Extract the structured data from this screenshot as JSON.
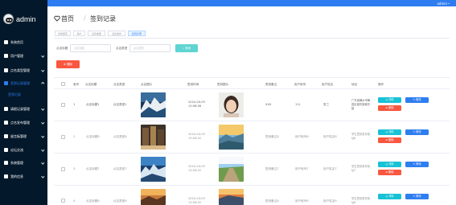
{
  "topbar": {
    "user": "admin"
  },
  "sidebar": {
    "brand": "admin",
    "items": [
      {
        "label": "系统首页",
        "has_arrow": false
      },
      {
        "label": "用户管理",
        "has_arrow": true
      },
      {
        "label": "点名类型管理",
        "has_arrow": true
      },
      {
        "label": "签到记录管理",
        "has_arrow": true,
        "active": true
      },
      {
        "label": "请假记录管理",
        "has_arrow": true
      },
      {
        "label": "点名发布管理",
        "has_arrow": true
      },
      {
        "label": "留言板管理",
        "has_arrow": true
      },
      {
        "label": "论坛交流",
        "has_arrow": true
      },
      {
        "label": "系统管理",
        "has_arrow": true
      },
      {
        "label": "我的信息",
        "has_arrow": true
      }
    ],
    "sub_item": "签到记录"
  },
  "header": {
    "home": "首页",
    "separator": "/",
    "current": "签到记录"
  },
  "tags": [
    "系统首页",
    "用户",
    "点名类型",
    "点名发布",
    "签到记录"
  ],
  "search": {
    "label1": "点名标题",
    "placeholder1": "点名标题",
    "label2": "点名类型",
    "placeholder2": "点名类型",
    "search_button": "查询"
  },
  "delete_button": "删除",
  "table": {
    "headers": [
      "索号",
      "点名标题",
      "点名类型",
      "点名图片",
      "签到时间",
      "签到图片",
      "签到备注",
      "用户帐号",
      "用户姓名",
      "地址",
      "操作"
    ],
    "rows": [
      {
        "index": "1",
        "title": "点名标题1",
        "type": "点名类型1",
        "time": "2024-04-09 13:58:56",
        "remark": "XXX",
        "account": "111",
        "name": "张三",
        "address": "广东省梅州市梅县区城东镇城东镇",
        "muted": false
      },
      {
        "index": "2",
        "title": "点名标题8",
        "type": "点名类型8",
        "time": "2024-04-09 13:56:52",
        "remark": "签到备注8",
        "account": "用户帐号8",
        "name": "用户姓名8",
        "address": "学生签到发布地址8",
        "muted": true
      },
      {
        "index": "3",
        "title": "点名标题7",
        "type": "点名类型7",
        "time": "2024-04-09 13:56:52",
        "remark": "签到备注7",
        "account": "用户帐号7",
        "name": "用户姓名7",
        "address": "学生签到发布地址7",
        "muted": true
      },
      {
        "index": "4",
        "title": "点名标题6",
        "type": "点名类型6",
        "time": "2024-04-09 13:56:52",
        "remark": "签到备注6",
        "account": "用户帐号6",
        "name": "用户姓名6",
        "address": "学生签到发布地址6",
        "muted": true
      }
    ],
    "actions": {
      "detail": "详情",
      "edit": "修改",
      "delete": "删除"
    }
  },
  "colors": {
    "primary": "#2e7df0",
    "sidebar": "#03182b",
    "danger": "#fa5740",
    "info": "#18c2d6",
    "search": "#5fd4d2"
  },
  "icons": [
    "home-icon",
    "user-icon",
    "menu-icon",
    "edit-icon",
    "search-icon",
    "heart-icon"
  ]
}
